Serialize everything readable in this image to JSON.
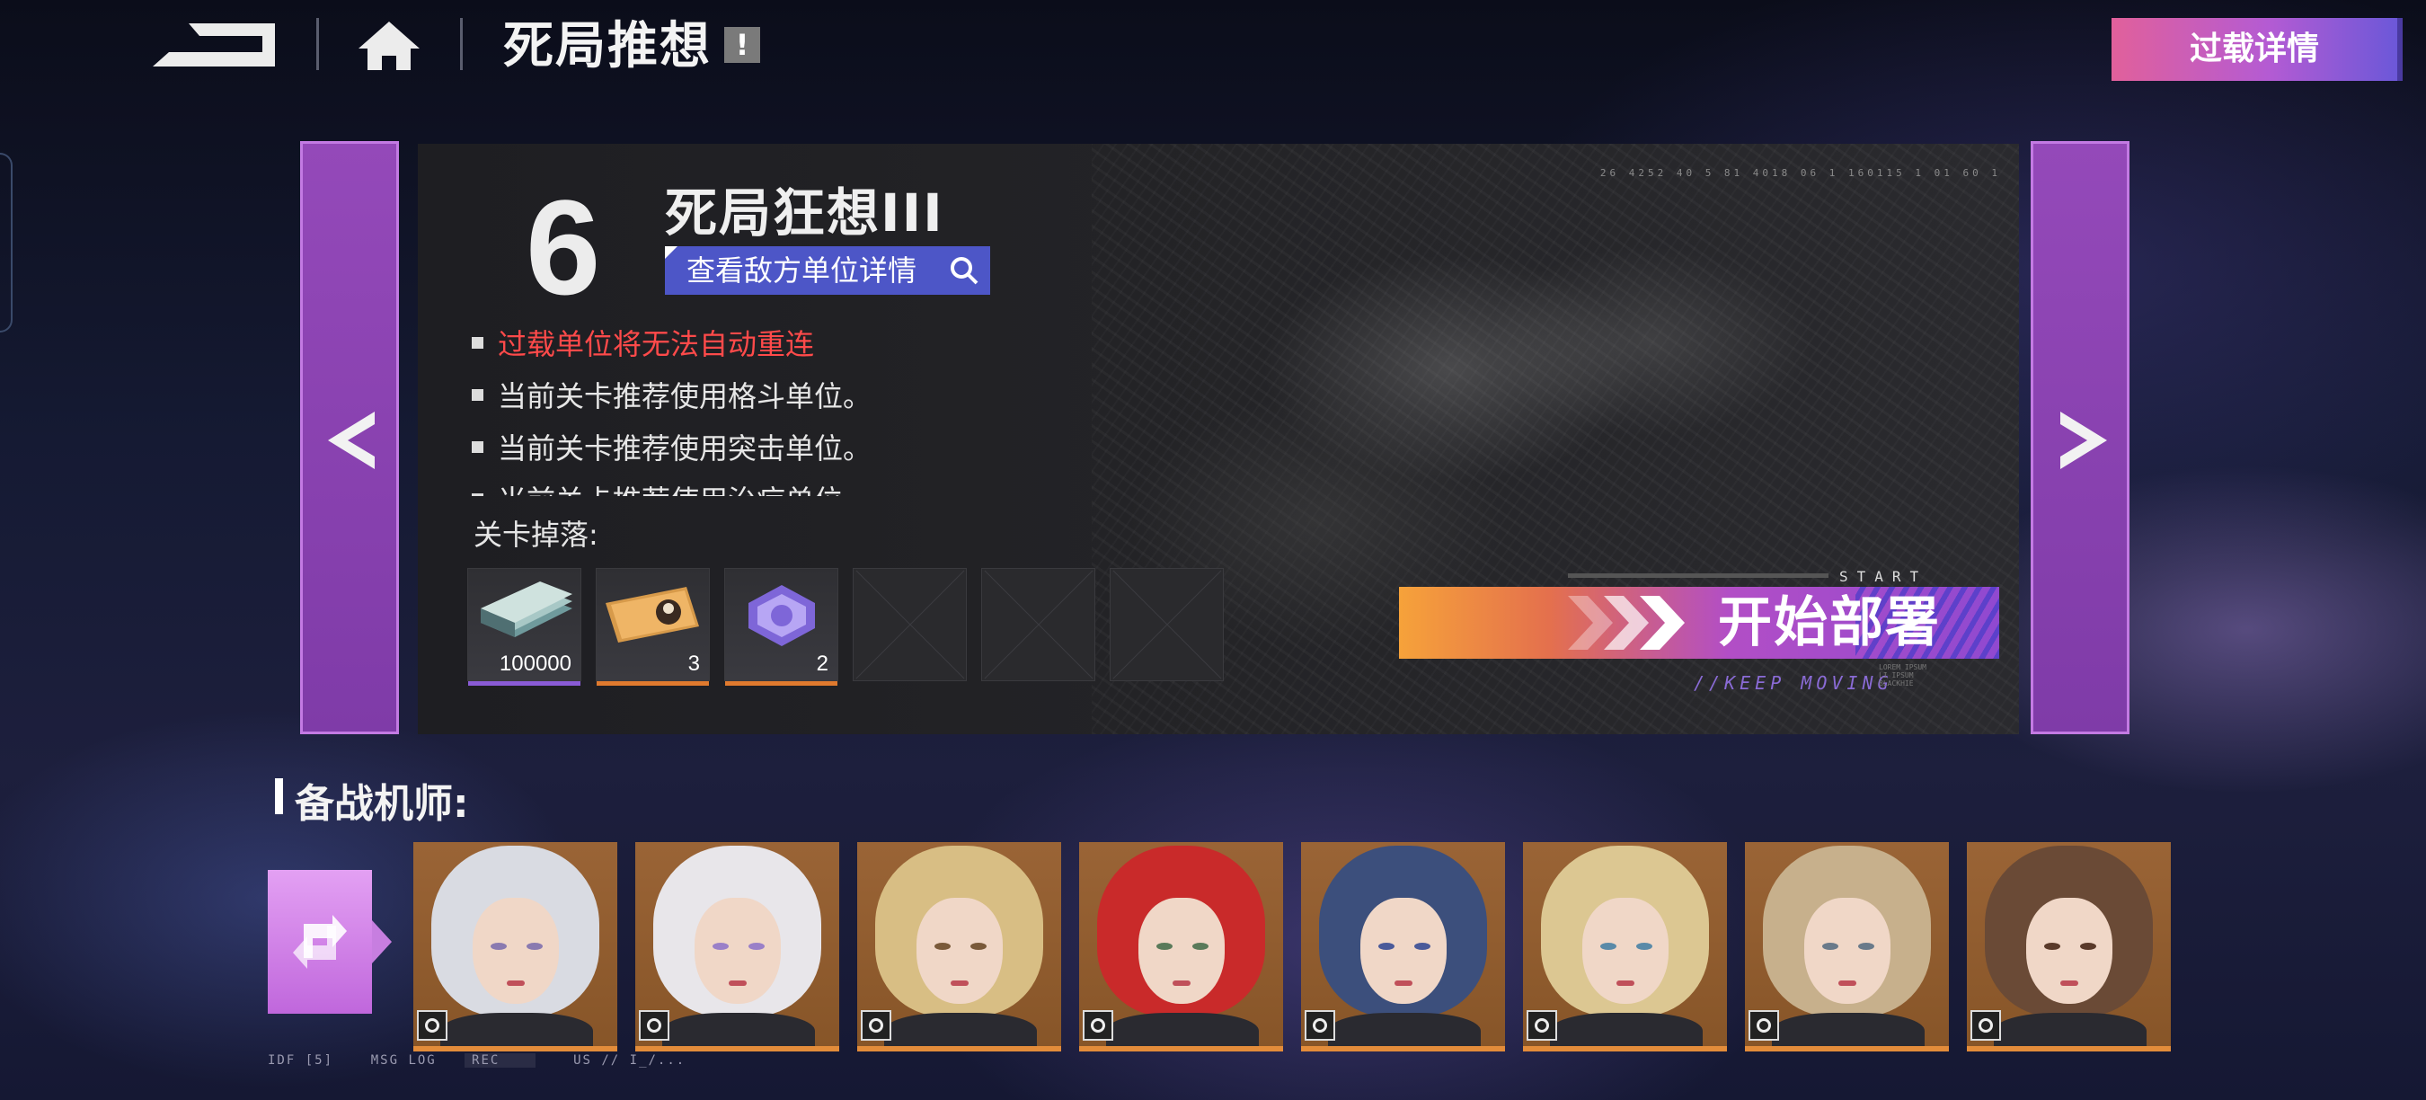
{
  "header": {
    "title": "死局推想",
    "info_mark": "!",
    "overload_button": "过载详情"
  },
  "stage": {
    "number": "6",
    "name": "死局狂想III",
    "enemy_button": "查看敌方单位详情",
    "map_code": "26 4252 40 5 81 4018 06 1 160115 1 01 60 1",
    "tips": [
      "过载单位将无法自动重连",
      "当前关卡推荐使用格斗单位。",
      "当前关卡推荐使用突击单位。",
      "当前关卡推荐使用治疗单位。"
    ],
    "drops_label": "关卡掉落:",
    "drops": [
      {
        "qty": "100000",
        "icon": "cash-stack-icon",
        "color": "#8a5bd6"
      },
      {
        "qty": "3",
        "icon": "ticket-icon",
        "color": "#e07a2e"
      },
      {
        "qty": "2",
        "icon": "crystal-icon",
        "color": "#e07a2e"
      },
      {
        "qty": "",
        "icon": "empty-slot"
      },
      {
        "qty": "",
        "icon": "empty-slot"
      },
      {
        "qty": "",
        "icon": "empty-slot"
      }
    ],
    "start_label": "START",
    "deploy_button": "开始部署",
    "keep_moving": "//KEEP MOVING",
    "tiny_text": "LOREM IPSUM\nLI IPSUM\nBLACKHIE"
  },
  "pilots": {
    "label": "备战机师:",
    "cards": [
      {
        "hair": "#d9dbe2",
        "eye": "#8a7ab0",
        "class_icon": "fighter-icon"
      },
      {
        "hair": "#e8e6ea",
        "eye": "#9a80c8",
        "class_icon": "shield-icon"
      },
      {
        "hair": "#d8be84",
        "eye": "#7a5a3a",
        "class_icon": "assault-icon"
      },
      {
        "hair": "#c92a2a",
        "eye": "#5a7a5a",
        "class_icon": "sniper-icon"
      },
      {
        "hair": "#3c4f7c",
        "eye": "#4a5a9a",
        "class_icon": "target-icon"
      },
      {
        "hair": "#dcc792",
        "eye": "#5a8aa8",
        "class_icon": "assault-icon"
      },
      {
        "hair": "#c7b08c",
        "eye": "#6a7a8a",
        "class_icon": "target-icon"
      },
      {
        "hair": "#6a4a36",
        "eye": "#5a3a2a",
        "class_icon": "fighter-icon"
      }
    ]
  },
  "footer": {
    "idf": "IDF [5]",
    "msg": "MSG LOG",
    "rec": "REC",
    "us": "US // I_/..."
  }
}
